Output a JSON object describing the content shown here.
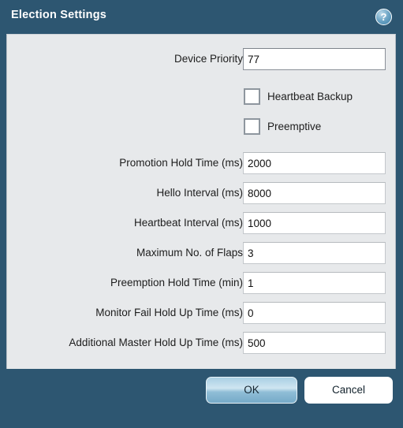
{
  "dialog": {
    "title": "Election Settings",
    "help_icon": "help-circle-icon",
    "help_glyph": "?",
    "colors": {
      "frame": "#2d5671",
      "panel": "#e7e9eb",
      "ok_accent": "#a9cfe3",
      "text": "#1d1d1d"
    }
  },
  "form": {
    "fields": [
      {
        "label": "Device Priority",
        "value": "77",
        "focused": true
      },
      {
        "label": "Promotion Hold Time (ms)",
        "value": "2000",
        "focused": false
      },
      {
        "label": "Hello Interval (ms)",
        "value": "8000",
        "focused": false
      },
      {
        "label": "Heartbeat Interval (ms)",
        "value": "1000",
        "focused": false
      },
      {
        "label": "Maximum No. of Flaps",
        "value": "3",
        "focused": false
      },
      {
        "label": "Preemption Hold Time (min)",
        "value": "1",
        "focused": false
      },
      {
        "label": "Monitor Fail Hold Up Time (ms)",
        "value": "0",
        "focused": false
      },
      {
        "label": "Additional Master Hold Up Time (ms)",
        "value": "500",
        "focused": false
      }
    ],
    "checkboxes": [
      {
        "label": "Heartbeat Backup",
        "checked": false
      },
      {
        "label": "Preemptive",
        "checked": false
      }
    ]
  },
  "footer": {
    "ok_label": "OK",
    "cancel_label": "Cancel"
  }
}
